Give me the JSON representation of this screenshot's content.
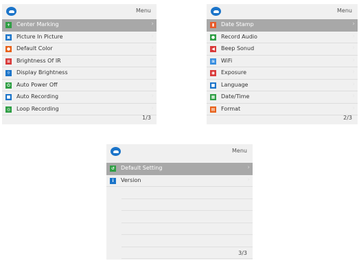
{
  "panels": [
    {
      "title": "Menu",
      "page": "1/3",
      "items": [
        {
          "label": "Center Marking",
          "icon": "crosshair-icon",
          "color": "#2f9e44",
          "selected": true
        },
        {
          "label": "Picture In Picture",
          "icon": "picture-in-picture-icon",
          "color": "#1b74c9"
        },
        {
          "label": "Default Color",
          "icon": "palette-icon",
          "color": "#e8611a"
        },
        {
          "label": "Brightness Of IR",
          "icon": "ir-brightness-icon",
          "color": "#d93a3a"
        },
        {
          "label": "Display Brightness",
          "icon": "brightness-icon",
          "color": "#1b74c9"
        },
        {
          "label": "Auto Power Off",
          "icon": "power-icon",
          "color": "#2f9e44"
        },
        {
          "label": "Auto Recording",
          "icon": "video-camera-icon",
          "color": "#1b74c9"
        },
        {
          "label": "Loop Recording",
          "icon": "loop-record-icon",
          "color": "#2f9e44"
        }
      ]
    },
    {
      "title": "Menu",
      "page": "2/3",
      "items": [
        {
          "label": "Date Stamp",
          "icon": "date-stamp-icon",
          "color": "#e85a2a",
          "selected": true
        },
        {
          "label": "Record Audio",
          "icon": "microphone-icon",
          "color": "#2f9e44"
        },
        {
          "label": "Beep Sonud",
          "icon": "speaker-icon",
          "color": "#d93a3a"
        },
        {
          "label": "WiFi",
          "icon": "wifi-icon",
          "color": "#3a8fe0"
        },
        {
          "label": "Exposure",
          "icon": "exposure-icon",
          "color": "#d93a3a"
        },
        {
          "label": "Language",
          "icon": "language-icon",
          "color": "#1b74c9"
        },
        {
          "label": "Date/Time",
          "icon": "calendar-icon",
          "color": "#2f9e44"
        },
        {
          "label": "Format",
          "icon": "format-icon",
          "color": "#e8611a"
        }
      ]
    },
    {
      "title": "Menu",
      "page": "3/3",
      "items": [
        {
          "label": "Default Setting",
          "icon": "reset-icon",
          "color": "#2f9e44",
          "selected": true
        },
        {
          "label": "Version",
          "icon": "info-icon",
          "color": "#1b74c9"
        }
      ],
      "empty_rows": 6
    }
  ]
}
